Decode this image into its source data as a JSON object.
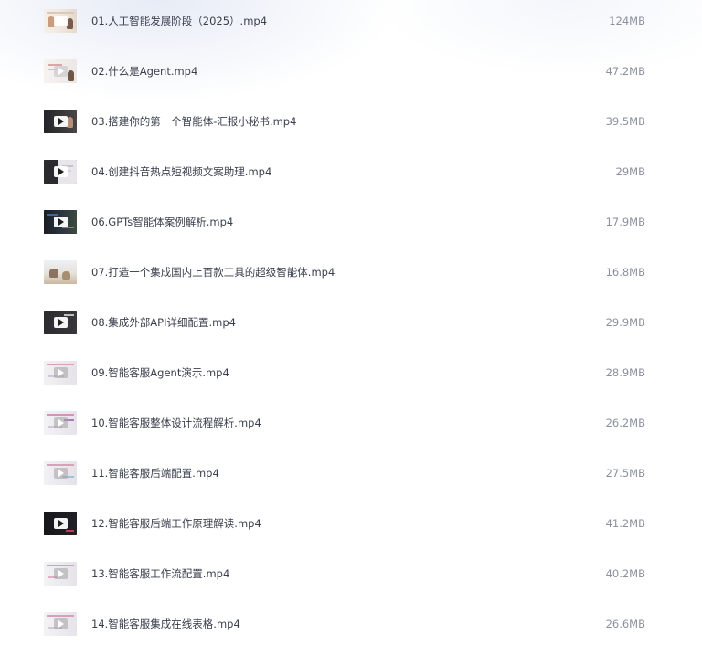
{
  "files": [
    {
      "name": "01.人工智能发展阶段（2025）.mp4",
      "size": "124MB",
      "thumbnail": "presenter-with-slides"
    },
    {
      "name": "02.什么是Agent.mp4",
      "size": "47.2MB",
      "thumbnail": "presenter-with-slides"
    },
    {
      "name": "03.搭建你的第一个智能体-汇报小秘书.mp4",
      "size": "39.5MB",
      "thumbnail": "dark-video"
    },
    {
      "name": "04.创建抖音热点短视频文案助理.mp4",
      "size": "29MB",
      "thumbnail": "dark-video"
    },
    {
      "name": "06.GPTs智能体案例解析.mp4",
      "size": "17.9MB",
      "thumbnail": "dark-video"
    },
    {
      "name": "07.打造一个集成国内上百款工具的超级智能体.mp4",
      "size": "16.8MB",
      "thumbnail": "photo-video"
    },
    {
      "name": "08.集成外部API详细配置.mp4",
      "size": "29.9MB",
      "thumbnail": "dark-video"
    },
    {
      "name": "09.智能客服Agent演示.mp4",
      "size": "28.9MB",
      "thumbnail": "light-video"
    },
    {
      "name": "10.智能客服整体设计流程解析.mp4",
      "size": "26.2MB",
      "thumbnail": "light-video"
    },
    {
      "name": "11.智能客服后端配置.mp4",
      "size": "27.5MB",
      "thumbnail": "light-video"
    },
    {
      "name": "12.智能客服后端工作原理解读.mp4",
      "size": "41.2MB",
      "thumbnail": "dark-video"
    },
    {
      "name": "13.智能客服工作流配置.mp4",
      "size": "40.2MB",
      "thumbnail": "light-video"
    },
    {
      "name": "14.智能客服集成在线表格.mp4",
      "size": "26.6MB",
      "thumbnail": "light-video"
    }
  ],
  "colors": {
    "file_name": "#3a3f4d",
    "file_size": "#8a909c",
    "background": "#ffffff"
  }
}
